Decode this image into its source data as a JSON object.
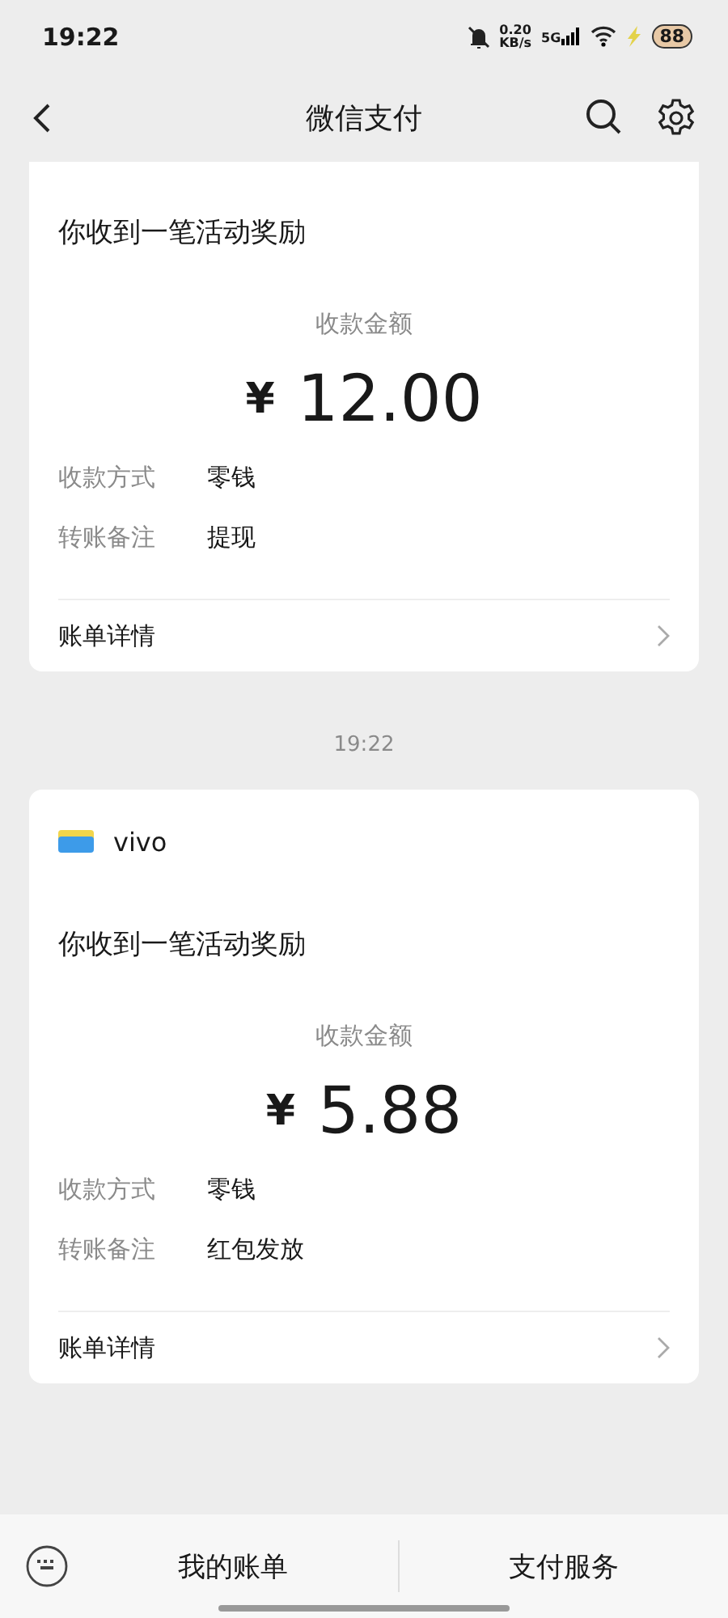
{
  "status_bar": {
    "time": "19:22",
    "net_speed": "0.20",
    "net_unit": "KB/s",
    "network": "5G",
    "battery": "88"
  },
  "header": {
    "title": "微信支付"
  },
  "messages": [
    {
      "title": "你收到一笔活动奖励",
      "amount_label": "收款金额",
      "currency": "¥",
      "amount": "12.00",
      "fields": [
        {
          "label": "收款方式",
          "value": "零钱"
        },
        {
          "label": "转账备注",
          "value": "提现"
        }
      ],
      "detail_link": "账单详情"
    },
    {
      "time": "19:22",
      "source": "vivo",
      "title": "你收到一笔活动奖励",
      "amount_label": "收款金额",
      "currency": "¥",
      "amount": "5.88",
      "fields": [
        {
          "label": "收款方式",
          "value": "零钱"
        },
        {
          "label": "转账备注",
          "value": "红包发放"
        }
      ],
      "detail_link": "账单详情"
    }
  ],
  "bottom_bar": {
    "items": [
      "我的账单",
      "支付服务"
    ]
  }
}
